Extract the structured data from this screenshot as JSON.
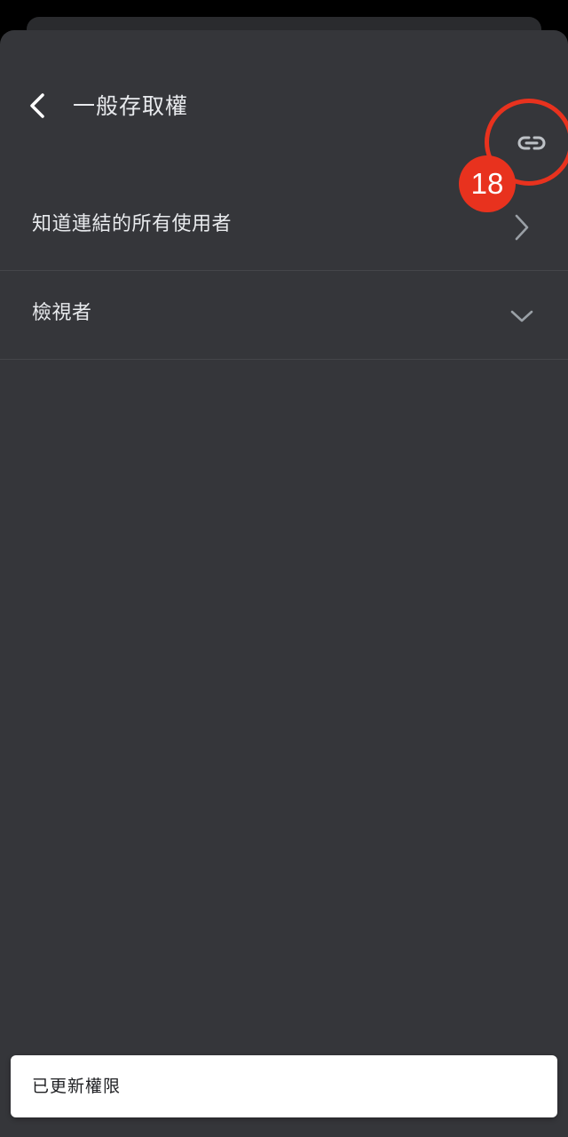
{
  "header": {
    "title": "一般存取權",
    "back_icon": "chevron-left-icon",
    "link_icon": "link-icon"
  },
  "general_access": {
    "label": "知道連結的所有使用者",
    "trailing_icon": "chevron-right-icon"
  },
  "role": {
    "label": "檢視者",
    "trailing_icon": "chevron-down-icon"
  },
  "annotation": {
    "step_number": "18",
    "color": "#e8321e"
  },
  "snackbar": {
    "message": "已更新權限"
  },
  "colors": {
    "sheet_background": "#35363a",
    "text_primary": "#e8eaed",
    "snackbar_background": "#ffffff"
  }
}
